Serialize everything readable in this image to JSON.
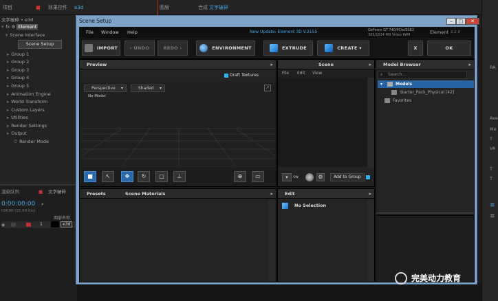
{
  "background": {
    "tabs": [
      "项目",
      "效果控件",
      "e3d",
      "图层",
      "合成",
      "文字破碎"
    ],
    "project_title": "文字破碎 • e3d",
    "effect_label": "Element",
    "scene_interface": "Scene Interface",
    "scene_setup_button": "Scene Setup",
    "groups": [
      "Group 1",
      "Group 2",
      "Group 3",
      "Group 4",
      "Group 5"
    ],
    "sections": [
      "Animation Engine",
      "World Transform",
      "Custom Layers",
      "Utilities",
      "Render Settings",
      "Output"
    ],
    "render_mode": "Render Mode",
    "timeline": {
      "tab_render": "渲染队列",
      "tab_comp": "文字破碎",
      "timecode": "0:00:00:00",
      "fps": "00000 (25.00 fps)",
      "layer_name_header": "图层名称",
      "layer_number": "1",
      "layer_name": "e3d"
    },
    "right_panel_items": [
      "Ave",
      "Me",
      "T",
      "VA",
      "T",
      "T",
      "RA"
    ]
  },
  "dialog": {
    "title": "Scene Setup",
    "menu": [
      "File",
      "Window",
      "Help"
    ],
    "update_notice": "New Update: Element 3D V.2155",
    "gpu_info": "GeForce GT 740/PCIe/SSE2",
    "gpu_ram": "385/1024 MB Video RAM",
    "product": "Element",
    "version": "2.2.0",
    "toolbar": {
      "import": "IMPORT",
      "undo": "UNDO",
      "redo": "REDO",
      "environment": "ENVIRONMENT",
      "extrude": "EXTRUDE",
      "create": "CREATE",
      "close": "X",
      "ok": "OK"
    },
    "preview": {
      "title": "Preview",
      "draft_textures": "Draft Textures",
      "camera_dropdown": "Perspective",
      "shading_dropdown": "Shaded",
      "no_model": "No Model"
    },
    "scene": {
      "title": "Scene",
      "menu": [
        "File",
        "Edit",
        "View"
      ],
      "add_to_group": "Add to Group"
    },
    "model_browser": {
      "title": "Model Browser",
      "search_placeholder": "Search...",
      "models_folder": "Models",
      "pack_item": "Starter_Pack_Physical [42]",
      "favorites": "Favorites"
    },
    "presets_tab": "Presets",
    "scene_materials_tab": "Scene Materials",
    "edit": {
      "title": "Edit",
      "no_selection": "No Selection"
    },
    "colors": {
      "accent_blue": "#2fb0f0",
      "frame_blue": "#7ea2c8",
      "update_blue": "#4aa8e8"
    }
  },
  "watermark": "完美动力教育"
}
